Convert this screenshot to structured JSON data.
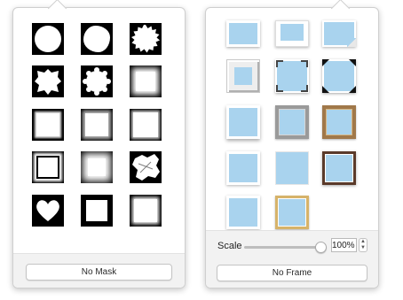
{
  "mask_picker": {
    "masks": [
      {
        "name": "circle"
      },
      {
        "name": "wavy-circle"
      },
      {
        "name": "scalloped-circle"
      },
      {
        "name": "irregular-star"
      },
      {
        "name": "cog-circle"
      },
      {
        "name": "soft-square"
      },
      {
        "name": "rough-square"
      },
      {
        "name": "torn-square"
      },
      {
        "name": "chalk-square"
      },
      {
        "name": "brush-square"
      },
      {
        "name": "blur-square"
      },
      {
        "name": "grunge-square"
      },
      {
        "name": "heart"
      },
      {
        "name": "thin-border-square"
      },
      {
        "name": "faded-square"
      }
    ],
    "no_mask_label": "No Mask"
  },
  "frame_picker": {
    "frames": [
      {
        "name": "white-plain"
      },
      {
        "name": "white-mat"
      },
      {
        "name": "page-curl"
      },
      {
        "name": "bevel-white"
      },
      {
        "name": "photo-corners"
      },
      {
        "name": "black-corners"
      },
      {
        "name": "white-shadow"
      },
      {
        "name": "silver-frame"
      },
      {
        "name": "wood-frame"
      },
      {
        "name": "white-border"
      },
      {
        "name": "plain-blue"
      },
      {
        "name": "dark-frame"
      },
      {
        "name": "white-thin"
      },
      {
        "name": "gold-frame"
      }
    ],
    "scale_label": "Scale",
    "scale_value": "100%",
    "scale_fraction": 1.0,
    "no_frame_label": "No Frame"
  },
  "colors": {
    "photo_blue": "#a9d3ee",
    "panel_gray": "#f2f2f2"
  }
}
